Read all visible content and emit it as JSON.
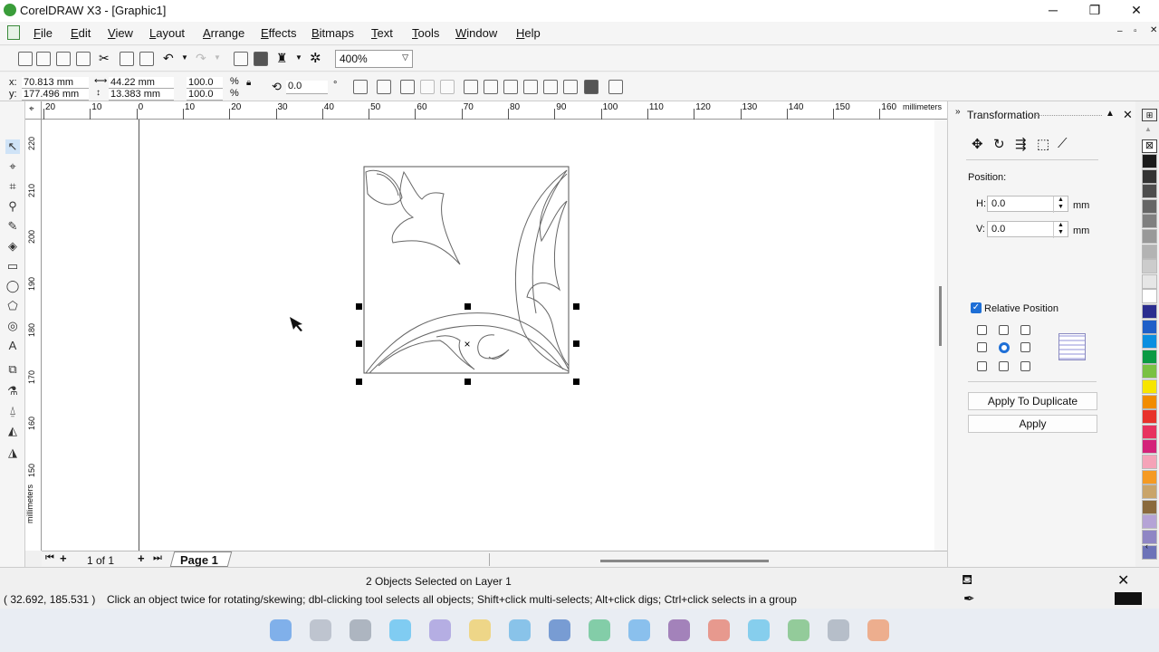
{
  "window": {
    "title": "CorelDRAW X3 - [Graphic1]",
    "controls": {
      "minimize": "─",
      "maximize": "❐",
      "close": "✕"
    }
  },
  "menu": [
    {
      "label": "File",
      "id": "file"
    },
    {
      "label": "Edit",
      "id": "edit"
    },
    {
      "label": "View",
      "id": "view"
    },
    {
      "label": "Layout",
      "id": "layout"
    },
    {
      "label": "Arrange",
      "id": "arrange"
    },
    {
      "label": "Effects",
      "id": "effects"
    },
    {
      "label": "Bitmaps",
      "id": "bitmaps"
    },
    {
      "label": "Text",
      "id": "text"
    },
    {
      "label": "Tools",
      "id": "tools"
    },
    {
      "label": "Window",
      "id": "window"
    },
    {
      "label": "Help",
      "id": "help"
    }
  ],
  "toolbar": {
    "zoom": "400%"
  },
  "property_bar": {
    "x_label": "x:",
    "x_value": "70.813 mm",
    "y_label": "y:",
    "y_value": "177.496 mm",
    "width_value": "44.22 mm",
    "height_value": "13.383 mm",
    "scale_x": "100.0",
    "scale_y": "100.0",
    "percent": "%",
    "rotation": "0.0",
    "degree": "°"
  },
  "rulers": {
    "unit": "millimeters",
    "h_ticks": [
      "20",
      "10",
      "0",
      "10",
      "20",
      "30",
      "40",
      "50",
      "60",
      "70",
      "80",
      "90",
      "100",
      "110",
      "120",
      "130",
      "140",
      "150",
      "160"
    ],
    "v_ticks": [
      "220",
      "210",
      "200",
      "190",
      "180",
      "170",
      "160",
      "150"
    ],
    "v_unit": "millimeters"
  },
  "page_nav": {
    "count": "1 of 1",
    "tab": "Page 1"
  },
  "docker": {
    "title": "Transformation",
    "position_label": "Position:",
    "h_label": "H:",
    "h_value": "0.0",
    "h_unit": "mm",
    "v_label": "V:",
    "v_value": "0.0",
    "v_unit": "mm",
    "relative_label": "Relative Position",
    "relative_checked": true,
    "apply_duplicate": "Apply To Duplicate",
    "apply": "Apply"
  },
  "palette": {
    "colors": [
      "#1a1a1a",
      "#333333",
      "#4d4d4d",
      "#666666",
      "#808080",
      "#999999",
      "#b3b3b3",
      "#cccccc",
      "#e6e6e6",
      "#ffffff",
      "#2b2d8f",
      "#1e5fc8",
      "#0a8fe0",
      "#0a9a44",
      "#7ac143",
      "#f7e500",
      "#f28c00",
      "#e8322b",
      "#e8325f",
      "#d4237a",
      "#f5a3b8",
      "#f59a23",
      "#c9a46a",
      "#8a6a3d",
      "#b5a3d6",
      "#8f86c4",
      "#6d73b8"
    ]
  },
  "status": {
    "selection": "2 Objects Selected on Layer 1",
    "coords": "( 32.692, 185.531 )",
    "hint": "Click an object twice for rotating/skewing; dbl-clicking tool selects all objects; Shift+click multi-selects; Alt+click digs; Ctrl+click selects in a group"
  }
}
